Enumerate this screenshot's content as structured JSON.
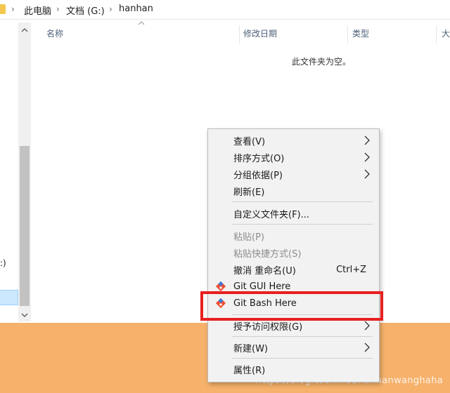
{
  "breadcrumb": {
    "items": [
      "此电脑",
      "文档 (G:)",
      "hanhan"
    ]
  },
  "nav": {
    "drive_label": ":)",
    "scroll_up_icon": "chevron-up-icon",
    "scroll_down_icon": "chevron-down-icon"
  },
  "columns": {
    "name": "名称",
    "modified": "修改日期",
    "type": "类型",
    "size": "大"
  },
  "empty_message": "此文件夹为空。",
  "context_menu": {
    "view": "查看(V)",
    "sort": "排序方式(O)",
    "group": "分组依据(P)",
    "refresh": "刷新(E)",
    "customize": "自定义文件夹(F)...",
    "paste": "粘贴(P)",
    "paste_shortcut": "粘贴快捷方式(S)",
    "undo_rename": "撤消 重命名(U)",
    "undo_shortcut": "Ctrl+Z",
    "git_gui": "Git GUI Here",
    "git_bash": "Git Bash Here",
    "grant_access": "授予访问权限(G)",
    "new": "新建(W)",
    "properties": "属性(R)"
  },
  "watermark": "https://blog.csdn.net/hanhanwanghaha",
  "colors": {
    "highlight": "#e82020",
    "band": "#f6b16b",
    "menu_bg": "#f2f2f2"
  }
}
